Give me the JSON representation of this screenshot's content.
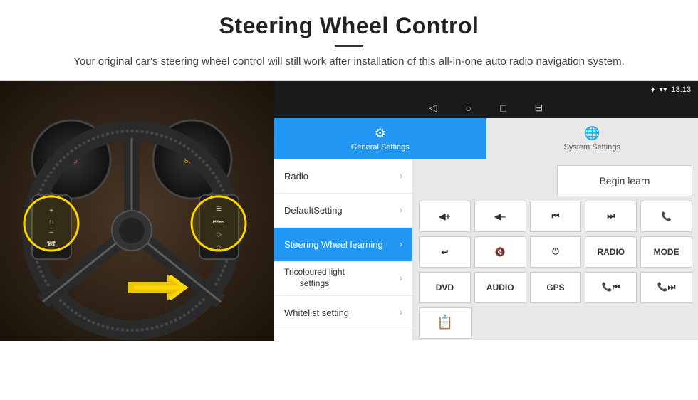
{
  "header": {
    "title": "Steering Wheel Control",
    "subtitle": "Your original car's steering wheel control will still work after installation of this all-in-one auto radio navigation system."
  },
  "status_bar": {
    "location_icon": "♦",
    "signal_icon": "▾",
    "time": "13:13"
  },
  "nav_bar": {
    "back_icon": "◁",
    "home_icon": "○",
    "recent_icon": "□",
    "screenshot_icon": "⊟"
  },
  "tabs": [
    {
      "label": "General Settings",
      "icon": "⚙",
      "active": true
    },
    {
      "label": "System Settings",
      "icon": "🌐",
      "active": false
    }
  ],
  "menu_items": [
    {
      "label": "Radio",
      "active": false
    },
    {
      "label": "DefaultSetting",
      "active": false
    },
    {
      "label": "Steering Wheel learning",
      "active": true
    },
    {
      "label": "Tricoloured light settings",
      "active": false
    },
    {
      "label": "Whitelist setting",
      "active": false
    }
  ],
  "panel": {
    "begin_learn_label": "Begin learn",
    "buttons_row1": [
      {
        "label": "◀+",
        "type": "vol_up"
      },
      {
        "label": "◀–",
        "type": "vol_down"
      },
      {
        "label": "⏮",
        "type": "prev_track"
      },
      {
        "label": "⏭",
        "type": "next_track"
      },
      {
        "label": "☎",
        "type": "phone"
      }
    ],
    "buttons_row2": [
      {
        "label": "↩",
        "type": "back"
      },
      {
        "label": "◀✕",
        "type": "mute"
      },
      {
        "label": "⏻",
        "type": "power"
      },
      {
        "label": "RADIO",
        "type": "radio"
      },
      {
        "label": "MODE",
        "type": "mode"
      }
    ],
    "buttons_row3": [
      {
        "label": "DVD",
        "type": "dvd"
      },
      {
        "label": "AUDIO",
        "type": "audio"
      },
      {
        "label": "GPS",
        "type": "gps"
      },
      {
        "label": "📞⏮",
        "type": "phone_prev"
      },
      {
        "label": "📞⏭",
        "type": "phone_next"
      }
    ],
    "list_icon_btn": "≡"
  }
}
